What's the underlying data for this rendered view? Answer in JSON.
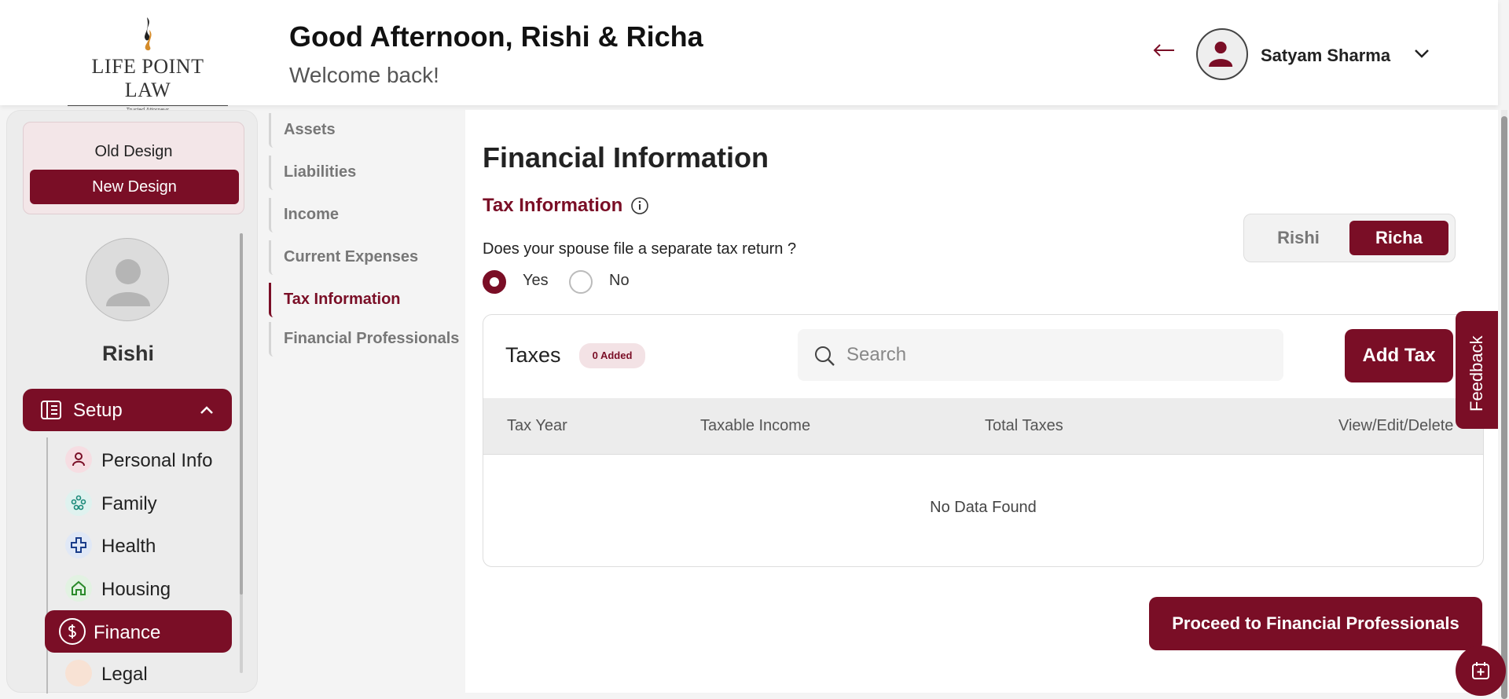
{
  "header": {
    "logo_text": "LIFE POINT LAW",
    "logo_sub": "Trusted Attorneys",
    "greeting": "Good Afternoon, Rishi & Richa",
    "welcome": "Welcome back!",
    "user_name": "Satyam Sharma"
  },
  "sidebar": {
    "old_design": "Old Design",
    "new_design": "New Design",
    "profile_name": "Rishi",
    "setup_label": "Setup",
    "items": [
      {
        "label": "Personal Info",
        "icon": "person-icon"
      },
      {
        "label": "Family",
        "icon": "family-icon"
      },
      {
        "label": "Health",
        "icon": "health-cross-icon"
      },
      {
        "label": "Housing",
        "icon": "house-icon"
      },
      {
        "label": "Finance",
        "icon": "dollar-icon"
      },
      {
        "label": "Legal",
        "icon": "legal-icon"
      }
    ]
  },
  "subnav": {
    "items": [
      "Assets",
      "Liabilities",
      "Income",
      "Current Expenses",
      "Tax Information",
      "Financial Professionals"
    ],
    "active": "Tax Information"
  },
  "main": {
    "title": "Financial Information",
    "section": "Tax Information",
    "question": "Does your spouse file a separate tax return ?",
    "yes": "Yes",
    "no": "No",
    "toggle": {
      "rishi": "Rishi",
      "richa": "Richa",
      "active": "Richa"
    },
    "taxes_label": "Taxes",
    "badge": "0 Added",
    "search_placeholder": "Search",
    "add_tax": "Add Tax",
    "columns": [
      "Tax Year",
      "Taxable Income",
      "Total Taxes",
      "View/Edit/Delete"
    ],
    "empty": "No Data Found",
    "proceed": "Proceed to Financial Professionals"
  },
  "feedback": "Feedback",
  "colors": {
    "brand": "#7a0e26",
    "badge_bg": "#f3e2e5"
  }
}
